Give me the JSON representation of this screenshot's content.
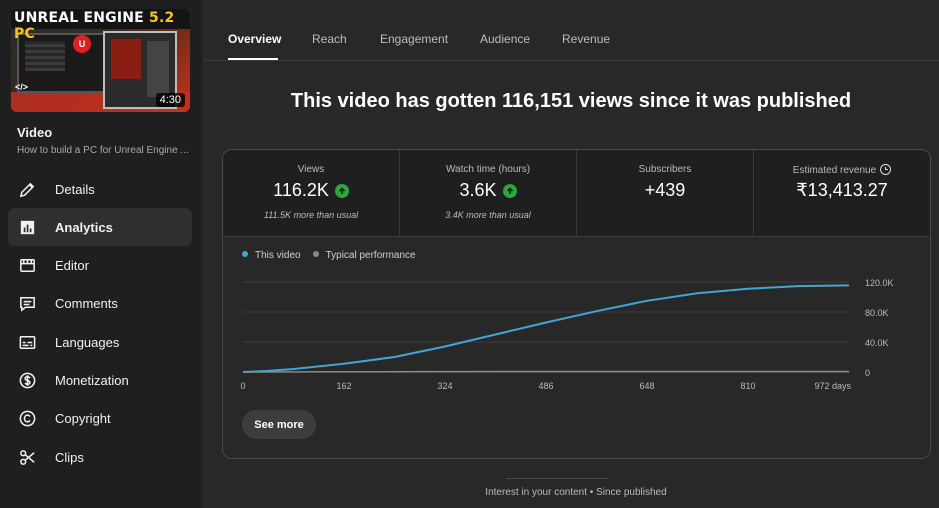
{
  "video": {
    "thumbnail_title_a": "UNREAL ENGINE",
    "thumbnail_title_b": "5.2 PC",
    "duration": "4:30",
    "section_label": "Video",
    "title_truncated": "How to build a PC for Unreal Engine ..."
  },
  "sidebar": {
    "items": [
      {
        "label": "Details",
        "icon": "pencil-icon"
      },
      {
        "label": "Analytics",
        "icon": "analytics-icon",
        "active": true
      },
      {
        "label": "Editor",
        "icon": "editor-icon"
      },
      {
        "label": "Comments",
        "icon": "comments-icon"
      },
      {
        "label": "Languages",
        "icon": "subtitles-icon"
      },
      {
        "label": "Monetization",
        "icon": "dollar-icon"
      },
      {
        "label": "Copyright",
        "icon": "copyright-icon"
      },
      {
        "label": "Clips",
        "icon": "scissors-icon"
      }
    ]
  },
  "tabs": [
    "Overview",
    "Reach",
    "Engagement",
    "Audience",
    "Revenue"
  ],
  "headline": "This video has gotten 116,151 views since it was published",
  "metrics": [
    {
      "label": "Views",
      "value": "116.2K",
      "note": "111.5K more than usual",
      "trend": "up"
    },
    {
      "label": "Watch time (hours)",
      "value": "3.6K",
      "note": "3.4K more than usual",
      "trend": "up"
    },
    {
      "label": "Subscribers",
      "value": "+439",
      "note": ""
    },
    {
      "label": "Estimated revenue",
      "value": "₹13,413.27",
      "note": ""
    }
  ],
  "legend": {
    "this_video": "This video",
    "typical": "Typical performance"
  },
  "see_more": "See more",
  "footer": "Interest in your content • Since published",
  "colors": {
    "accent_line": "#3ea6d9",
    "typical_line": "#8a8a8a",
    "trend_up": "#2ba640"
  },
  "chart_data": {
    "type": "line",
    "x_ticks": [
      "0",
      "162",
      "324",
      "486",
      "648",
      "810",
      "972 days"
    ],
    "y_ticks": [
      "0",
      "40.0K",
      "80.0K",
      "120.0K"
    ],
    "ylim": [
      0,
      120000
    ],
    "xlim": [
      0,
      972
    ],
    "series": [
      {
        "name": "This video",
        "x": [
          0,
          40,
          81,
          162,
          243,
          324,
          405,
          486,
          567,
          648,
          729,
          810,
          891,
          972
        ],
        "y": [
          0,
          1500,
          4000,
          11000,
          20000,
          34000,
          50000,
          66000,
          81000,
          95000,
          105000,
          111000,
          114500,
          115500
        ]
      },
      {
        "name": "Typical performance",
        "x": [
          0,
          162,
          324,
          486,
          648,
          810,
          972
        ],
        "y": [
          0,
          300,
          500,
          600,
          700,
          700,
          700
        ]
      }
    ],
    "grid": true
  }
}
